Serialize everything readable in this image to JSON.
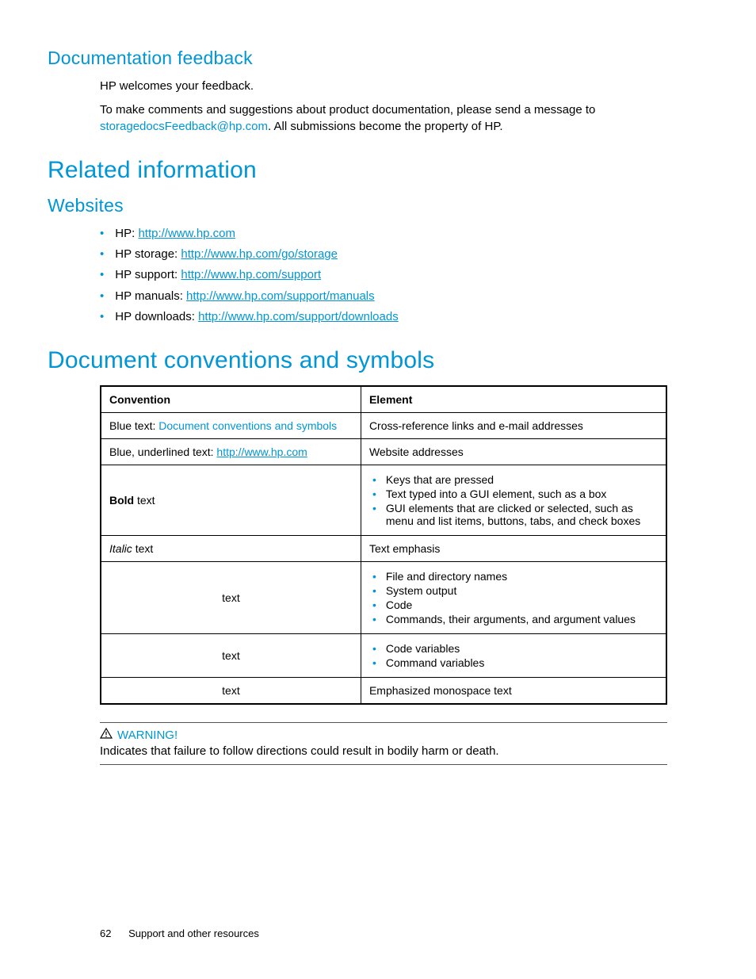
{
  "sections": {
    "docFeedback": {
      "heading": "Documentation feedback",
      "p1": "HP welcomes your feedback.",
      "p2a": "To make comments and suggestions about product documentation, please send a message to ",
      "email": "storagedocsFeedback@hp.com",
      "p2b": ". All submissions become the property of HP."
    },
    "related": {
      "heading": "Related information",
      "websitesHeading": "Websites",
      "items": [
        {
          "label": "HP: ",
          "url": "http://www.hp.com"
        },
        {
          "label": "HP storage: ",
          "url": "http://www.hp.com/go/storage"
        },
        {
          "label": "HP support: ",
          "url": "http://www.hp.com/support"
        },
        {
          "label": "HP manuals: ",
          "url": "http://www.hp.com/support/manuals"
        },
        {
          "label": "HP downloads: ",
          "url": "http://www.hp.com/support/downloads"
        }
      ]
    },
    "conventions": {
      "heading": "Document conventions and symbols",
      "header": {
        "col1": "Convention",
        "col2": "Element"
      },
      "rows": {
        "r1": {
          "c1a": "Blue text: ",
          "c1b": "Document conventions and symbols",
          "c2": "Cross-reference links and e-mail addresses"
        },
        "r2": {
          "c1a": "Blue, underlined text: ",
          "c1b": "http://www.hp.com",
          "c2": "Website addresses"
        },
        "r3": {
          "c1a": "Bold",
          "c1b": " text",
          "li1": "Keys that are pressed",
          "li2": "Text typed into a GUI element, such as a box",
          "li3": "GUI elements that are clicked or selected, such as menu and list items, buttons, tabs, and check boxes"
        },
        "r4": {
          "c1a": "Italic ",
          "c1b": " text",
          "c2": "Text emphasis"
        },
        "r5": {
          "c1": "text",
          "li1": "File and directory names",
          "li2": "System output",
          "li3": "Code",
          "li4": "Commands, their arguments, and argument values"
        },
        "r6": {
          "c1": "text",
          "li1": "Code variables",
          "li2": "Command variables"
        },
        "r7": {
          "c1": "text",
          "c2": "Emphasized monospace text"
        }
      }
    },
    "warning": {
      "label": "WARNING!",
      "text": "Indicates that failure to follow directions could result in bodily harm or death."
    }
  },
  "footer": {
    "page": "62",
    "title": "Support and other resources"
  }
}
